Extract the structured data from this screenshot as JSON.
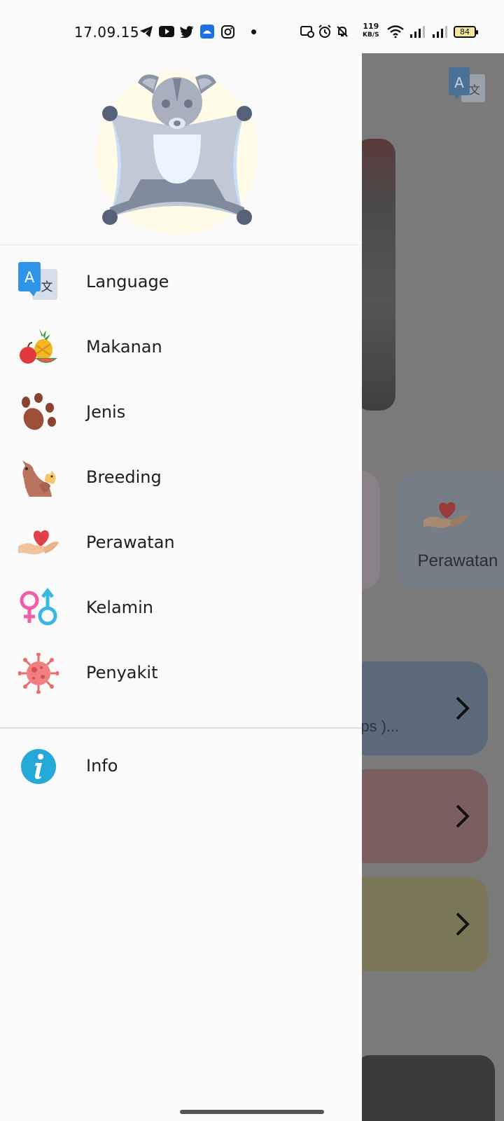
{
  "status_bar": {
    "time": "17.09.15",
    "net_speed_value": "119",
    "net_speed_unit": "KB/S",
    "battery": "84"
  },
  "drawer": {
    "menu": [
      {
        "label": "Language",
        "icon": "translate-icon"
      },
      {
        "label": "Makanan",
        "icon": "fruits-icon"
      },
      {
        "label": "Jenis",
        "icon": "paw-icon"
      },
      {
        "label": "Breeding",
        "icon": "kangaroo-icon"
      },
      {
        "label": "Perawatan",
        "icon": "heart-hand-icon"
      },
      {
        "label": "Kelamin",
        "icon": "gender-icon"
      },
      {
        "label": "Penyakit",
        "icon": "virus-icon"
      }
    ],
    "footer_menu": [
      {
        "label": "Info",
        "icon": "info-icon"
      }
    ]
  },
  "background": {
    "card_label": "Perawatan",
    "row_snippet": "eps )..."
  }
}
